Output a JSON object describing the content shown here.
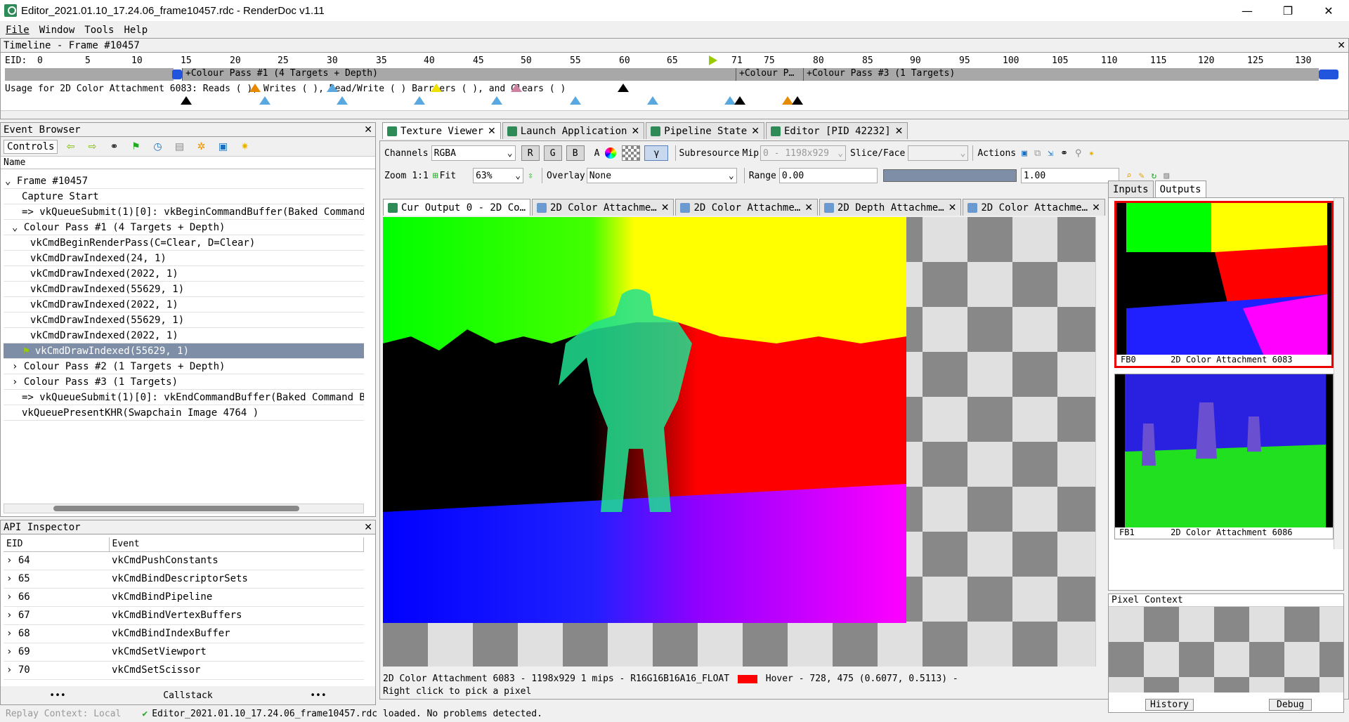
{
  "window": {
    "title": "Editor_2021.01.10_17.24.06_frame10457.rdc - RenderDoc v1.11",
    "min": "—",
    "max": "❐",
    "close": "✕"
  },
  "menu": [
    "File",
    "Window",
    "Tools",
    "Help"
  ],
  "timeline": {
    "title": "Timeline - Frame #10457",
    "eid_label": "EID:",
    "ticks": [
      "0",
      "5",
      "10",
      "15",
      "20",
      "25",
      "30",
      "35",
      "40",
      "45",
      "50",
      "55",
      "60",
      "65",
      "71",
      "75",
      "80",
      "85",
      "90",
      "95",
      "100",
      "105",
      "110",
      "115",
      "120",
      "125",
      "130"
    ],
    "bars": [
      "+Colour Pass #1 (4 Targets + Depth)",
      "+Colour P…",
      "+Colour Pass #3 (1 Targets)"
    ],
    "usage": "Usage for 2D Color Attachment 6083: Reads (  ), Writes (  ), Read/Write (  ) Barriers (  ), and Clears (  )"
  },
  "event_browser": {
    "title": "Event Browser",
    "controls_label": "Controls",
    "column": "Name",
    "rows": [
      "Frame #10457",
      "Capture Start",
      "=> vkQueueSubmit(1)[0]: vkBeginCommandBuffer(Baked Command",
      "Colour Pass #1 (4 Targets + Depth)",
      "vkCmdBeginRenderPass(C=Clear, D=Clear)",
      "vkCmdDrawIndexed(24, 1)",
      "vkCmdDrawIndexed(2022, 1)",
      "vkCmdDrawIndexed(55629, 1)",
      "vkCmdDrawIndexed(2022, 1)",
      "vkCmdDrawIndexed(55629, 1)",
      "vkCmdDrawIndexed(2022, 1)",
      "vkCmdDrawIndexed(55629, 1)",
      "Colour Pass #2 (1 Targets + Depth)",
      "Colour Pass #3 (1 Targets)",
      "=> vkQueueSubmit(1)[0]: vkEndCommandBuffer(Baked Command Bu",
      "vkQueuePresentKHR(Swapchain Image 4764 )"
    ]
  },
  "api_inspector": {
    "title": "API Inspector",
    "columns": [
      "EID",
      "Event"
    ],
    "rows": [
      [
        "64",
        "vkCmdPushConstants"
      ],
      [
        "65",
        "vkCmdBindDescriptorSets"
      ],
      [
        "66",
        "vkCmdBindPipeline"
      ],
      [
        "67",
        "vkCmdBindVertexBuffers"
      ],
      [
        "68",
        "vkCmdBindIndexBuffer"
      ],
      [
        "69",
        "vkCmdSetViewport"
      ],
      [
        "70",
        "vkCmdSetScissor"
      ]
    ],
    "callstack": "Callstack",
    "dots": "•••"
  },
  "main_tabs": [
    "Texture Viewer",
    "Launch Application",
    "Pipeline State",
    "Editor [PID 42232]"
  ],
  "toolbar": {
    "channels_label": "Channels",
    "channels_value": "RGBA",
    "r": "R",
    "g": "G",
    "b": "B",
    "a": "A",
    "gamma": "γ",
    "subresource": "Subresource",
    "mip_label": "Mip",
    "mip_value": "0 - 1198x929",
    "slice_label": "Slice/Face",
    "actions": "Actions",
    "zoom_label": "Zoom",
    "zoom_11": "1:1",
    "fit": "Fit",
    "zoom_value": "63%",
    "overlay_label": "Overlay",
    "overlay_value": "None",
    "range_label": "Range",
    "range_min": "0.00",
    "range_max": "1.00"
  },
  "texture_tabs": [
    "Cur Output 0 - 2D Co…",
    "2D Color Attachme…",
    "2D Color Attachme…",
    "2D Depth Attachme…",
    "2D Color Attachme…"
  ],
  "side_tabs": [
    "Inputs",
    "Outputs"
  ],
  "thumbs": [
    {
      "slot": "FB0",
      "name": "2D Color Attachment 6083"
    },
    {
      "slot": "FB1",
      "name": "2D Color Attachment 6086"
    }
  ],
  "pixel_context": {
    "title": "Pixel Context",
    "history": "History",
    "debug": "Debug"
  },
  "status": {
    "line1": "2D Color Attachment 6083 - 1198x929 1 mips - R16G16B16A16_FLOAT",
    "hover": "Hover -    728,  475 (0.6077, 0.5113)  -",
    "line2": "Right click to pick a pixel"
  },
  "statusbar": {
    "replay": "Replay Context: Local",
    "message": "Editor_2021.01.10_17.24.06_frame10457.rdc loaded. No problems detected."
  }
}
